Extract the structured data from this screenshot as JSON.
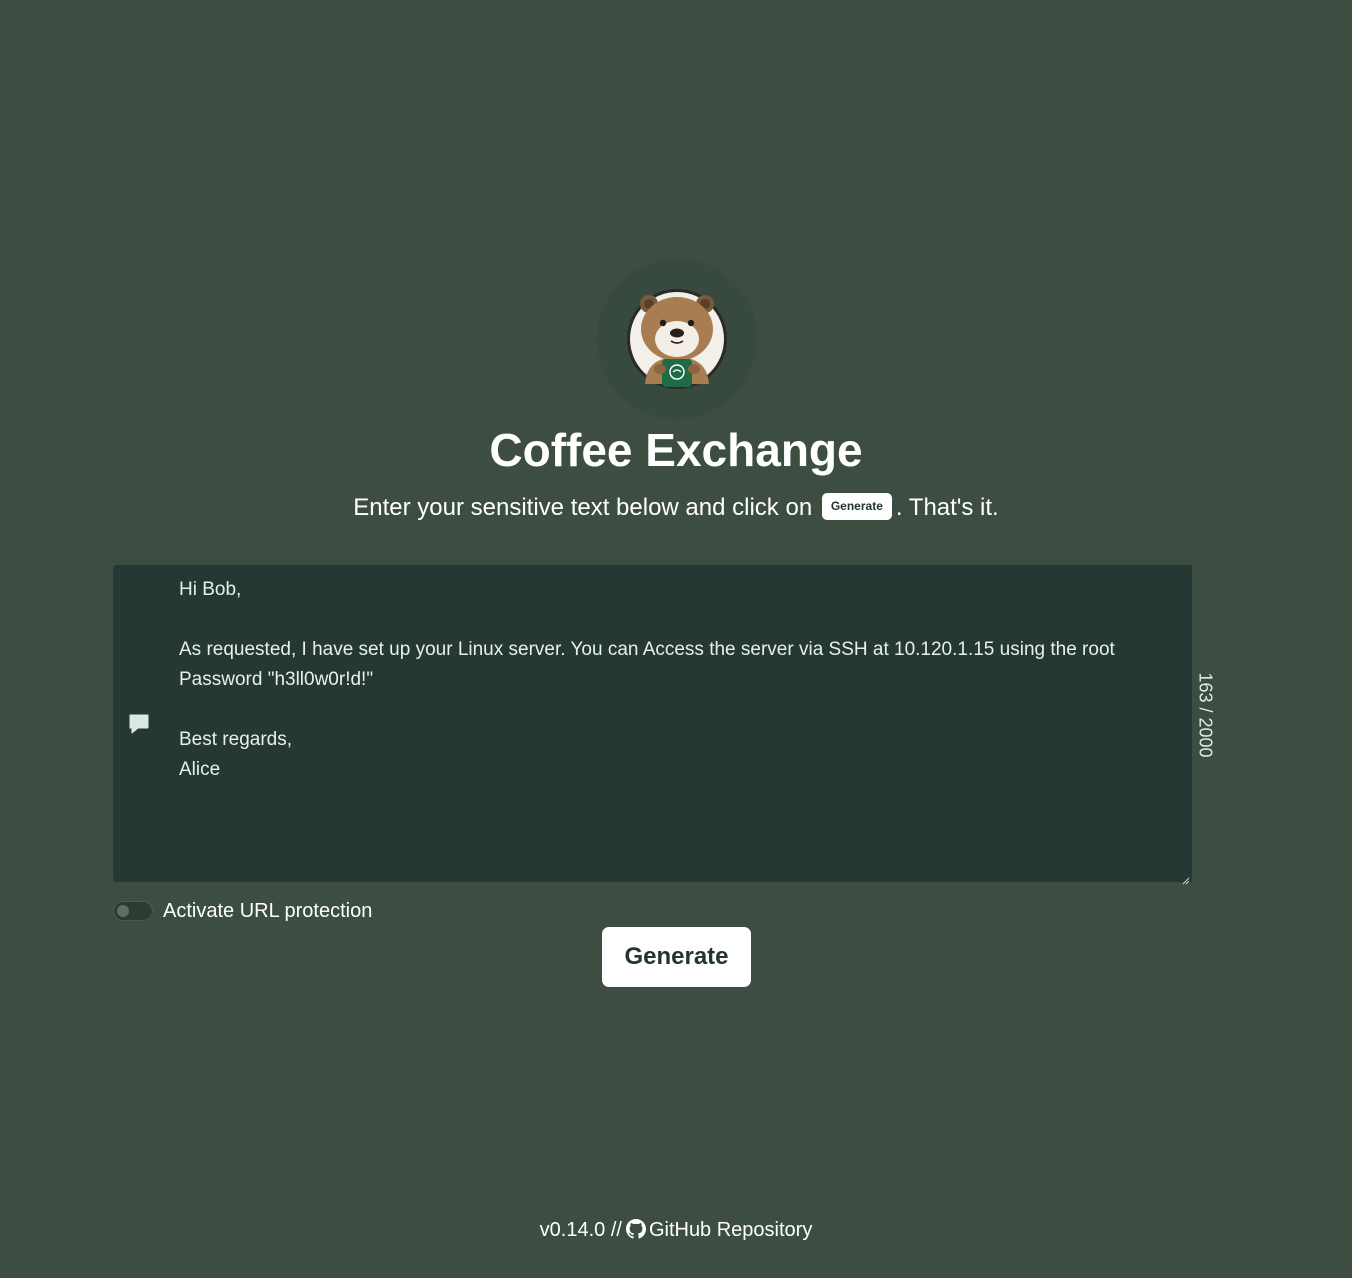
{
  "header": {
    "logo_icon": "otter-mascot-logo-icon",
    "title": "Coffee Exchange",
    "subtitle_before": "Enter your sensitive text below and click on",
    "subtitle_button": "Generate",
    "subtitle_after": ". That's it."
  },
  "editor": {
    "icon": "message-icon",
    "text": "Hi Bob,\n\nAs requested, I have set up your Linux server. You can Access the server via SSH at 10.120.1.15 using the root Password \"h3ll0w0r!d!\"\n\nBest regards,\nAlice",
    "counter": "163 / 2000"
  },
  "options": {
    "url_protection_label": "Activate URL protection",
    "url_protection_enabled": false
  },
  "actions": {
    "generate_label": "Generate"
  },
  "footer": {
    "version": "v0.14.0 //",
    "github_icon": "github-icon",
    "repo_link": "GitHub Repository"
  },
  "colors": {
    "background": "#3d4d41",
    "editor_background": "#253833",
    "button_background": "#ffffff",
    "button_text": "#243530"
  }
}
